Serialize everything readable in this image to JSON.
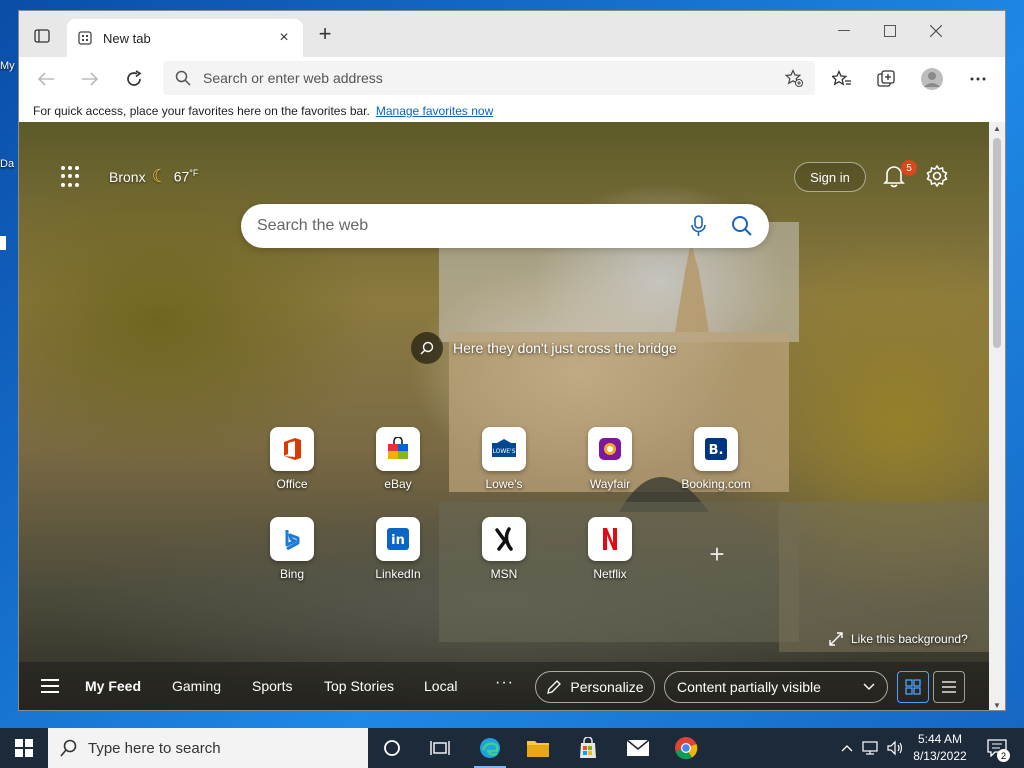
{
  "desktop": {
    "labels": [
      "My",
      "Da"
    ]
  },
  "browser": {
    "tab_title": "New tab",
    "new_tab_symbol": "+",
    "close_tab_symbol": "×",
    "address_placeholder": "Search or enter web address",
    "favbar_text": "For quick access, place your favorites here on the favorites bar.",
    "favbar_link": "Manage favorites now"
  },
  "newtab_page": {
    "location": "Bronx",
    "temperature": "67",
    "temp_unit": "°F",
    "sign_in": "Sign in",
    "notification_count": "5",
    "search_placeholder": "Search the web",
    "image_caption": "Here they don't just cross the bridge",
    "like_background": "Like this background?",
    "quick_links": [
      {
        "label": "Office",
        "color": "#d83b01",
        "glyph": "O"
      },
      {
        "label": "eBay",
        "color": "#e53238",
        "glyph": "e"
      },
      {
        "label": "Lowe's",
        "color": "#004990",
        "glyph": "Lowe's"
      },
      {
        "label": "Wayfair",
        "color": "#7b189f",
        "glyph": "W"
      },
      {
        "label": "Booking.com",
        "color": "#003580",
        "glyph": "B."
      },
      {
        "label": "Bing",
        "color": "#008373",
        "glyph": "b"
      },
      {
        "label": "LinkedIn",
        "color": "#0a66c2",
        "glyph": "in"
      },
      {
        "label": "MSN",
        "color": "#000000",
        "glyph": "✗"
      },
      {
        "label": "Netflix",
        "color": "#e50914",
        "glyph": "N"
      }
    ],
    "add_link_symbol": "+",
    "feed_tabs": [
      "My Feed",
      "Gaming",
      "Sports",
      "Top Stories",
      "Local"
    ],
    "more_symbol": "···",
    "personalize": "Personalize",
    "content_visibility": "Content partially visible"
  },
  "taskbar": {
    "search_placeholder": "Type here to search",
    "time": "5:44 AM",
    "date": "8/13/2022",
    "notification_count": "2"
  }
}
